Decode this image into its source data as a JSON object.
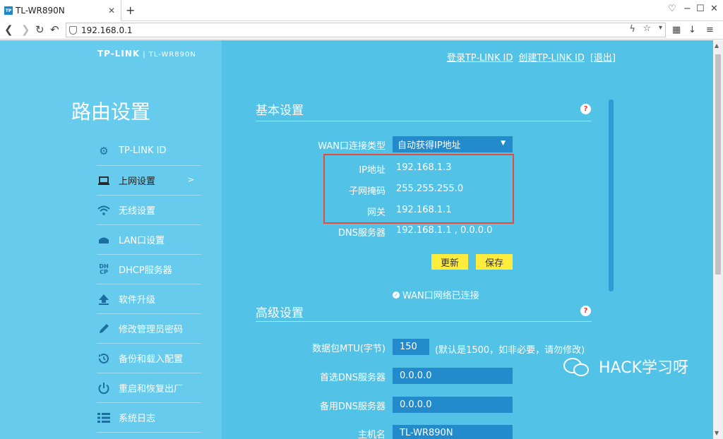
{
  "browser": {
    "tab_title": "TL-WR890N",
    "tab_favicon": "TP",
    "close_glyph": "✕",
    "newtab_glyph": "+",
    "url": "192.168.0.1"
  },
  "header": {
    "logo": "TP-LINK",
    "model": "| TL-WR890N",
    "links": [
      "登录TP-LINK ID",
      "创建TP-LINK ID",
      "[退出]"
    ]
  },
  "sidebar": {
    "title": "路由设置",
    "items": [
      {
        "label": "TP-LINK ID",
        "icon": "gear-icon"
      },
      {
        "label": "上网设置",
        "icon": "laptop-icon",
        "chevron": ">"
      },
      {
        "label": "无线设置",
        "icon": "wifi-icon"
      },
      {
        "label": "LAN口设置",
        "icon": "network-icon"
      },
      {
        "label": "DHCP服务器",
        "icon": "dhcp-icon",
        "icon_text_top": "DH",
        "icon_text_bottom": "CP"
      },
      {
        "label": "软件升级",
        "icon": "upload-icon"
      },
      {
        "label": "修改管理员密码",
        "icon": "pencil-icon"
      },
      {
        "label": "备份和载入配置",
        "icon": "restore-icon"
      },
      {
        "label": "重启和恢复出厂",
        "icon": "power-icon"
      },
      {
        "label": "系统日志",
        "icon": "log-icon"
      }
    ]
  },
  "basic": {
    "title": "基本设置",
    "help": "?",
    "wan_type_label": "WAN口连接类型",
    "wan_type_value": "自动获得IP地址",
    "ip_label": "IP地址",
    "ip_value": "192.168.1.3",
    "mask_label": "子网掩码",
    "mask_value": "255.255.255.0",
    "gateway_label": "网关",
    "gateway_value": "192.168.1.1",
    "dns_label": "DNS服务器",
    "dns_value": "192.168.1.1 , 0.0.0.0",
    "refresh_button": "更新",
    "save_button": "保存",
    "status": "WAN口网络已连接"
  },
  "advanced": {
    "title": "高级设置",
    "help": "?",
    "mtu_label": "数据包MTU(字节)",
    "mtu_value": "150",
    "mtu_hint": "(默认是1500，如非必要，请勿修改)",
    "dns1_label": "首选DNS服务器",
    "dns1_value": "0.0.0.0",
    "dns2_label": "备用DNS服务器",
    "dns2_value": "0.0.0.0",
    "hostname_label": "主机名",
    "hostname_value": "TL-WR890N"
  },
  "watermark": "HACK学习呀",
  "colors": {
    "page_bg": "#52c2e7",
    "sidebar_bg": "#67cbed",
    "input_bg": "#238bcb",
    "button_yellow": "#ffec3d",
    "highlight_border": "#e84b3c"
  }
}
